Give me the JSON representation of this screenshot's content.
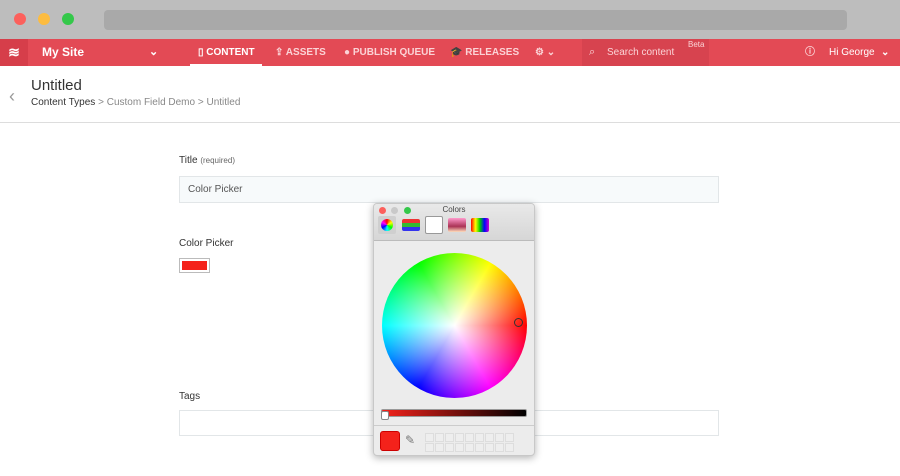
{
  "nav": {
    "site": "My Site",
    "items": [
      "CONTENT",
      "ASSETS",
      "PUBLISH QUEUE",
      "RELEASES"
    ],
    "search_placeholder": "Search content",
    "beta": "Beta",
    "user": "Hi George",
    "accent": "#e34a55"
  },
  "header": {
    "title": "Untitled",
    "breadcrumbs": [
      "Content Types",
      "Custom Field Demo",
      "Untitled"
    ]
  },
  "form": {
    "title_label": "Title",
    "title_required": "(required)",
    "title_value": "Color Picker",
    "color_label": "Color Picker",
    "color_value": "#f4221b",
    "tags_label": "Tags",
    "tags_value": ""
  },
  "colors_panel": {
    "title": "Colors",
    "selected_color": "#f4221b"
  }
}
